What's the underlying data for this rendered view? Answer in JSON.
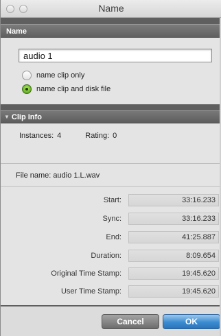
{
  "window": {
    "title": "Name"
  },
  "name_section": {
    "header": "Name",
    "input_value": "audio 1",
    "radio_options": [
      {
        "label": "name clip only",
        "checked": false
      },
      {
        "label": "name clip and disk file",
        "checked": true
      }
    ]
  },
  "clip_info": {
    "header": "Clip Info",
    "instances_label": "Instances:",
    "instances_value": "4",
    "rating_label": "Rating:",
    "rating_value": "0",
    "file_name": "File name: audio 1.L.wav",
    "times": [
      {
        "label": "Start:",
        "value": "33:16.233"
      },
      {
        "label": "Sync:",
        "value": "33:16.233"
      },
      {
        "label": "End:",
        "value": "41:25.887"
      },
      {
        "label": "Duration:",
        "value": "8:09.654"
      },
      {
        "label": "Original Time Stamp:",
        "value": "19:45.620"
      },
      {
        "label": "User Time Stamp:",
        "value": "19:45.620"
      }
    ]
  },
  "buttons": {
    "cancel": "Cancel",
    "ok": "OK"
  },
  "colors": {
    "ok_button": "#3b8bd1",
    "selected_radio": "#7ec434",
    "section_header": "#6a6a6a"
  }
}
